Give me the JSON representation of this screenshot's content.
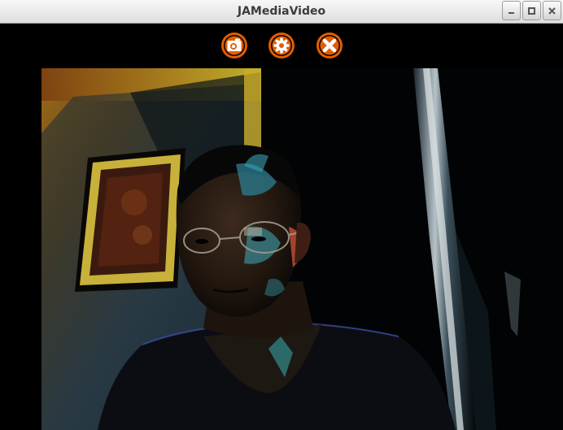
{
  "window": {
    "title": "JAMediaVideo"
  },
  "toolbar": {
    "buttons": [
      {
        "name": "capture",
        "icon": "camera-icon",
        "color": "#e35d00"
      },
      {
        "name": "settings",
        "icon": "gear-icon",
        "color": "#e35d00"
      },
      {
        "name": "close",
        "icon": "close-icon",
        "color": "#e35d00"
      }
    ]
  },
  "colors": {
    "accent": "#e35d00",
    "background": "#000000",
    "titlebar": "#e6e6e6"
  }
}
